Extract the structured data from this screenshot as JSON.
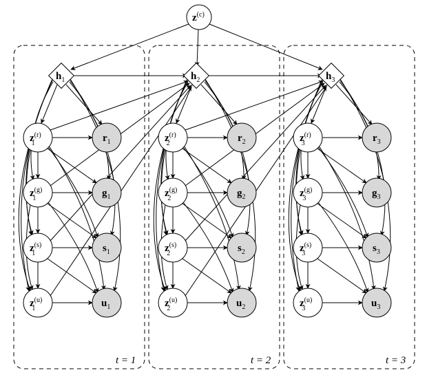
{
  "chart_data": {
    "type": "probabilistic-graphical-model",
    "title": "",
    "description": "Directed graphical model unrolled over three time steps with a shared context latent z^(c), per-step deterministic state h_t, four latent variable groups z^(r),z^(g),z^(s),z^(u) and corresponding observed variables r,g,s,u.",
    "time_steps": [
      1,
      2,
      3
    ],
    "context_node": "z^{(c)}",
    "per_step_deterministic": "h_t",
    "latent_groups": [
      "z^{(r)}",
      "z^{(g)}",
      "z^{(s)}",
      "z^{(u)}"
    ],
    "observed_groups": [
      "r",
      "g",
      "s",
      "u"
    ],
    "edges_intra_step": [
      "h_t -> z^{(r)}_t",
      "h_t -> z^{(g)}_t",
      "h_t -> z^{(s)}_t",
      "h_t -> z^{(u)}_t",
      "h_t -> r_t",
      "h_t -> g_t",
      "h_t -> s_t",
      "h_t -> u_t",
      "z^{(r)}_t -> r_t",
      "z^{(r)}_t -> z^{(g)}_t",
      "z^{(r)}_t -> g_t",
      "z^{(r)}_t -> z^{(s)}_t",
      "z^{(r)}_t -> s_t",
      "z^{(r)}_t -> z^{(u)}_t",
      "z^{(r)}_t -> u_t",
      "z^{(g)}_t -> g_t",
      "z^{(g)}_t -> z^{(s)}_t",
      "z^{(g)}_t -> s_t",
      "z^{(g)}_t -> z^{(u)}_t",
      "z^{(g)}_t -> u_t",
      "z^{(s)}_t -> s_t",
      "z^{(s)}_t -> z^{(u)}_t",
      "z^{(s)}_t -> u_t",
      "z^{(u)}_t -> u_t"
    ],
    "edges_inter_step": [
      "z^{(c)} -> h_1",
      "z^{(c)} -> h_2",
      "z^{(c)} -> h_3",
      "h_1 -> h_2",
      "h_2 -> h_3",
      "z^{(r)}_t -> h_{t+1}",
      "z^{(g)}_t -> h_{t+1}",
      "z^{(s)}_t -> h_{t+1}",
      "z^{(u)}_t -> h_{t+1}"
    ],
    "node_styles": {
      "latent": "white circle",
      "observed": "grey circle",
      "deterministic": "white diamond"
    }
  },
  "labels": {
    "zc": "z",
    "zc_sup": "(c)",
    "h": "h",
    "z_base": "z",
    "sup_r": "(r)",
    "sup_g": "(g)",
    "sup_s": "(s)",
    "sup_u": "(u)",
    "r": "r",
    "g": "g",
    "s": "s",
    "u": "u",
    "t1": "t = 1",
    "t2": "t = 2",
    "t3": "t = 3",
    "sub1": "1",
    "sub2": "2",
    "sub3": "3"
  }
}
